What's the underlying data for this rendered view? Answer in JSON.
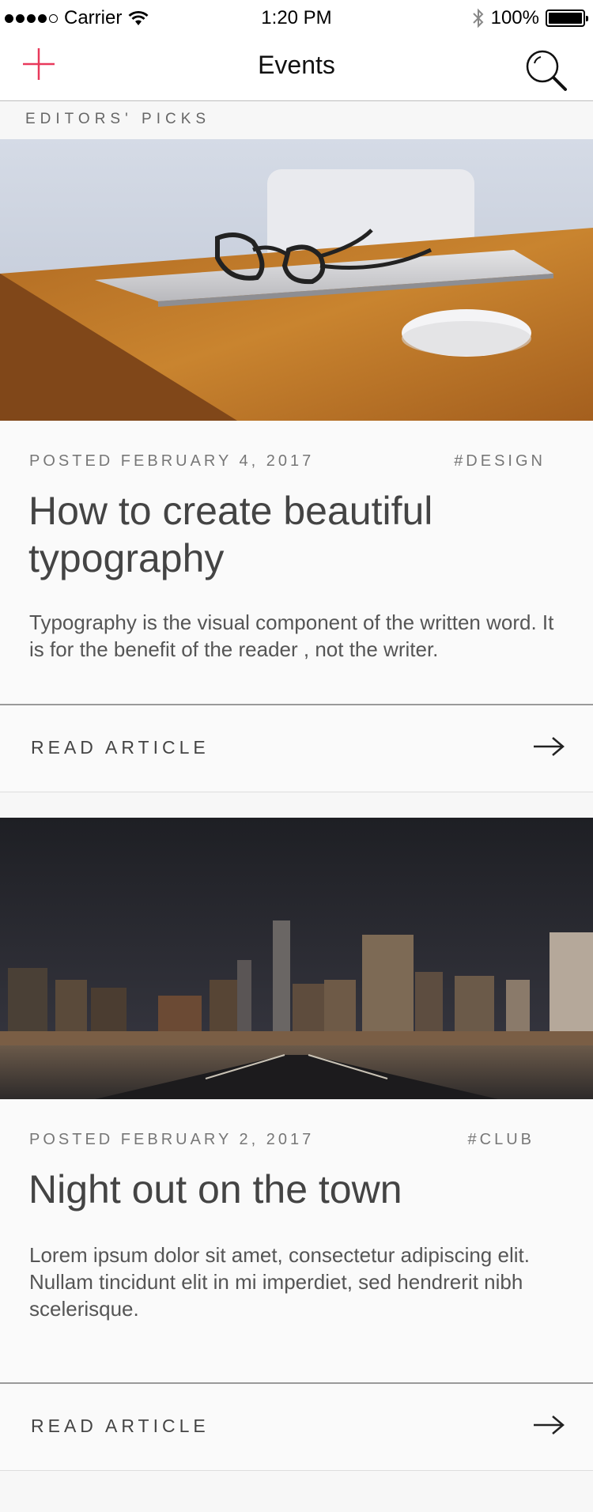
{
  "status_bar": {
    "carrier": "Carrier",
    "time": "1:20 PM",
    "battery": "100%"
  },
  "nav": {
    "title": "Events",
    "accent_color": "#e8395b"
  },
  "section": {
    "label": "EDITORS' PICKS"
  },
  "cards": [
    {
      "posted": "POSTED FEBRUARY 4, 2017",
      "tag": "#DESIGN",
      "title": "How to create beautiful typography",
      "body": "Typography is the visual component of the written word. It is for the benefit of the reader , not the writer.",
      "action_label": "READ ARTICLE"
    },
    {
      "posted": "POSTED FEBRUARY 2, 2017",
      "tag": "#CLUB",
      "title": "Night out on the town",
      "body": "Lorem ipsum dolor sit amet, consectetur adipiscing elit. Nullam tincidunt elit in mi imperdiet, sed hendrerit nibh scelerisque.",
      "action_label": "READ ARTICLE"
    }
  ]
}
